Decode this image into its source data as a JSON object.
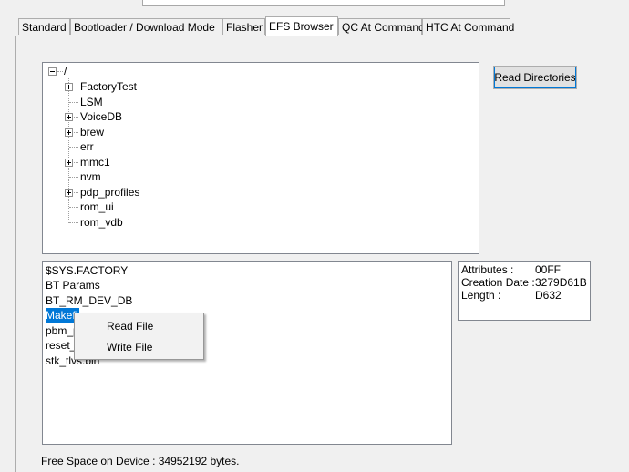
{
  "tabs": [
    {
      "label": "Standard",
      "active": false
    },
    {
      "label": "Bootloader / Download Mode",
      "active": false
    },
    {
      "label": "Flasher",
      "active": false
    },
    {
      "label": "EFS Browser",
      "active": true
    },
    {
      "label": "QC At Command",
      "active": false
    },
    {
      "label": "HTC At Command",
      "active": false
    }
  ],
  "tree": {
    "root": {
      "label": "/",
      "expanded": true
    },
    "children": [
      {
        "label": "FactoryTest",
        "expandable": true
      },
      {
        "label": "LSM",
        "expandable": false
      },
      {
        "label": "VoiceDB",
        "expandable": true
      },
      {
        "label": "brew",
        "expandable": true
      },
      {
        "label": "err",
        "expandable": false
      },
      {
        "label": "mmc1",
        "expandable": true
      },
      {
        "label": "nvm",
        "expandable": false
      },
      {
        "label": "pdp_profiles",
        "expandable": true
      },
      {
        "label": "rom_ui",
        "expandable": false
      },
      {
        "label": "rom_vdb",
        "expandable": false
      }
    ]
  },
  "read_directories_label": "Read Directories",
  "file_list": [
    {
      "label": "$SYS.FACTORY",
      "selected": false
    },
    {
      "label": "BT Params",
      "selected": false
    },
    {
      "label": "BT_RM_DEV_DB",
      "selected": false
    },
    {
      "label": "Makefi",
      "selected": true
    },
    {
      "label": "pbm_p",
      "selected": false
    },
    {
      "label": "reset_",
      "selected": false
    },
    {
      "label": "stk_tlvs.bin",
      "selected": false
    }
  ],
  "properties": [
    {
      "key": "Attributes :",
      "value": "00FF"
    },
    {
      "key": "Creation Date :",
      "value": "3279D61B"
    },
    {
      "key": "Length :",
      "value": "D632"
    }
  ],
  "context_menu": [
    "Read File",
    "Write File"
  ],
  "status_text": "Free Space on Device : 34952192 bytes.",
  "colors": {
    "selection": "#0078d7",
    "focus_outline": "#0078d7"
  }
}
